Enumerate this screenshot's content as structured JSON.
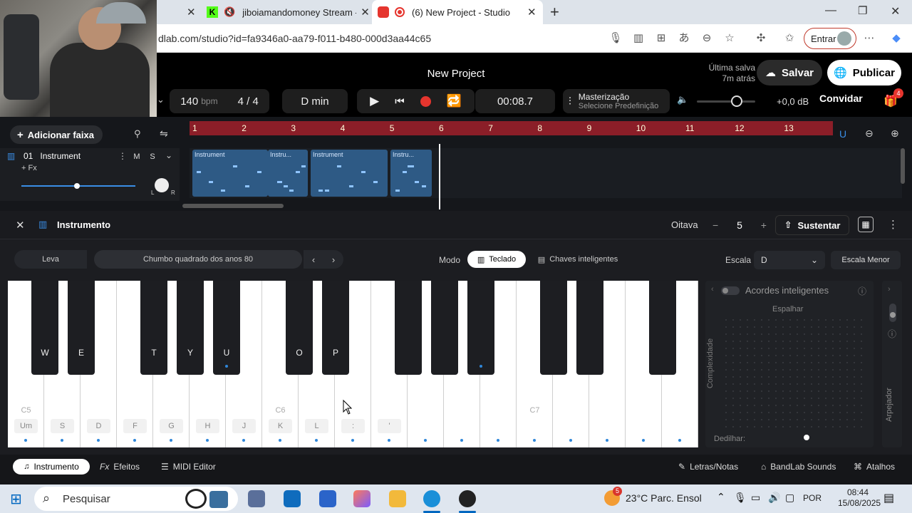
{
  "browser": {
    "tabs": [
      {
        "title": "jiboiamandomoney Stream -",
        "muted": true
      },
      {
        "title": "(6) New Project - Studio",
        "recording": true
      }
    ],
    "url": "dlab.com/studio?id=fa9346a0-aa79-f011-b480-000d3aa44c65",
    "signin_label": "Entrar"
  },
  "studio": {
    "project_title": "New Project",
    "last_saved_line1": "Última salva",
    "last_saved_line2": "7m atrás",
    "save_label": "Salvar",
    "publish_label": "Publicar",
    "bpm_value": "140",
    "bpm_unit": "bpm",
    "time_signature": "4 / 4",
    "key": "D min",
    "time": "00:08.7",
    "mastering_title": "Masterização",
    "mastering_sub": "Selecione Predefinição",
    "volume_db": "+0,0 dB",
    "invite_label": "Convidar",
    "gift_count": "4",
    "accent": "#e5352e"
  },
  "tracks": {
    "add_label": "Adicionar faixa",
    "bars": [
      "1",
      "2",
      "3",
      "4",
      "5",
      "6",
      "7",
      "8",
      "9",
      "10",
      "11",
      "12",
      "13"
    ],
    "track": {
      "number": "01",
      "name": "Instrument",
      "fx": "+ Fx",
      "mute": "M",
      "solo": "S",
      "pan_left": "L",
      "pan_right": "R"
    },
    "clips": [
      "Instrument",
      "Instru...",
      "Instrument",
      "Instru..."
    ]
  },
  "instrument": {
    "title": "Instrumento",
    "octave_label": "Oitava",
    "octave_value": "5",
    "sustain_label": "Sustentar",
    "leva_label": "Leva",
    "preset": "Chumbo quadrado dos anos 80",
    "mode_label": "Modo",
    "mode_keyboard": "Teclado",
    "mode_smart": "Chaves inteligentes",
    "scale_label": "Escala",
    "scale_value": "D",
    "scale_mode": "Escala Menor",
    "white_keys": [
      {
        "label": "Um",
        "note": "C5"
      },
      {
        "label": "S",
        "note": ""
      },
      {
        "label": "D",
        "note": ""
      },
      {
        "label": "F",
        "note": ""
      },
      {
        "label": "G",
        "note": ""
      },
      {
        "label": "H",
        "note": ""
      },
      {
        "label": "J",
        "note": ""
      },
      {
        "label": "K",
        "note": "C6"
      },
      {
        "label": "L",
        "note": ""
      },
      {
        "label": ":",
        "note": ""
      },
      {
        "label": "'",
        "note": ""
      },
      {
        "label": "",
        "note": ""
      },
      {
        "label": "",
        "note": ""
      },
      {
        "label": "",
        "note": ""
      },
      {
        "label": "",
        "note": "C7"
      },
      {
        "label": "",
        "note": ""
      },
      {
        "label": "",
        "note": ""
      },
      {
        "label": "",
        "note": ""
      },
      {
        "label": "",
        "note": ""
      }
    ],
    "black_keys": [
      "W",
      "E",
      "T",
      "Y",
      "U",
      "O",
      "P",
      "",
      "",
      "",
      "",
      "",
      ""
    ],
    "chords_title": "Acordes inteligentes",
    "spread_label": "Espalhar",
    "complexity_label": "Complexidade",
    "strum_label": "Dedilhar:",
    "arp_label": "Arpejador"
  },
  "bottom_tabs": {
    "instrument": "Instrumento",
    "effects": "Efeitos",
    "midi": "MIDI Editor",
    "lyrics": "Letras/Notas",
    "sounds": "BandLab Sounds",
    "shortcuts": "Atalhos"
  },
  "taskbar": {
    "search_placeholder": "Pesquisar",
    "weather_badge": "5",
    "weather": "23°C  Parc. Ensol",
    "lang": "POR",
    "time": "08:44",
    "date": "15/08/2025"
  }
}
